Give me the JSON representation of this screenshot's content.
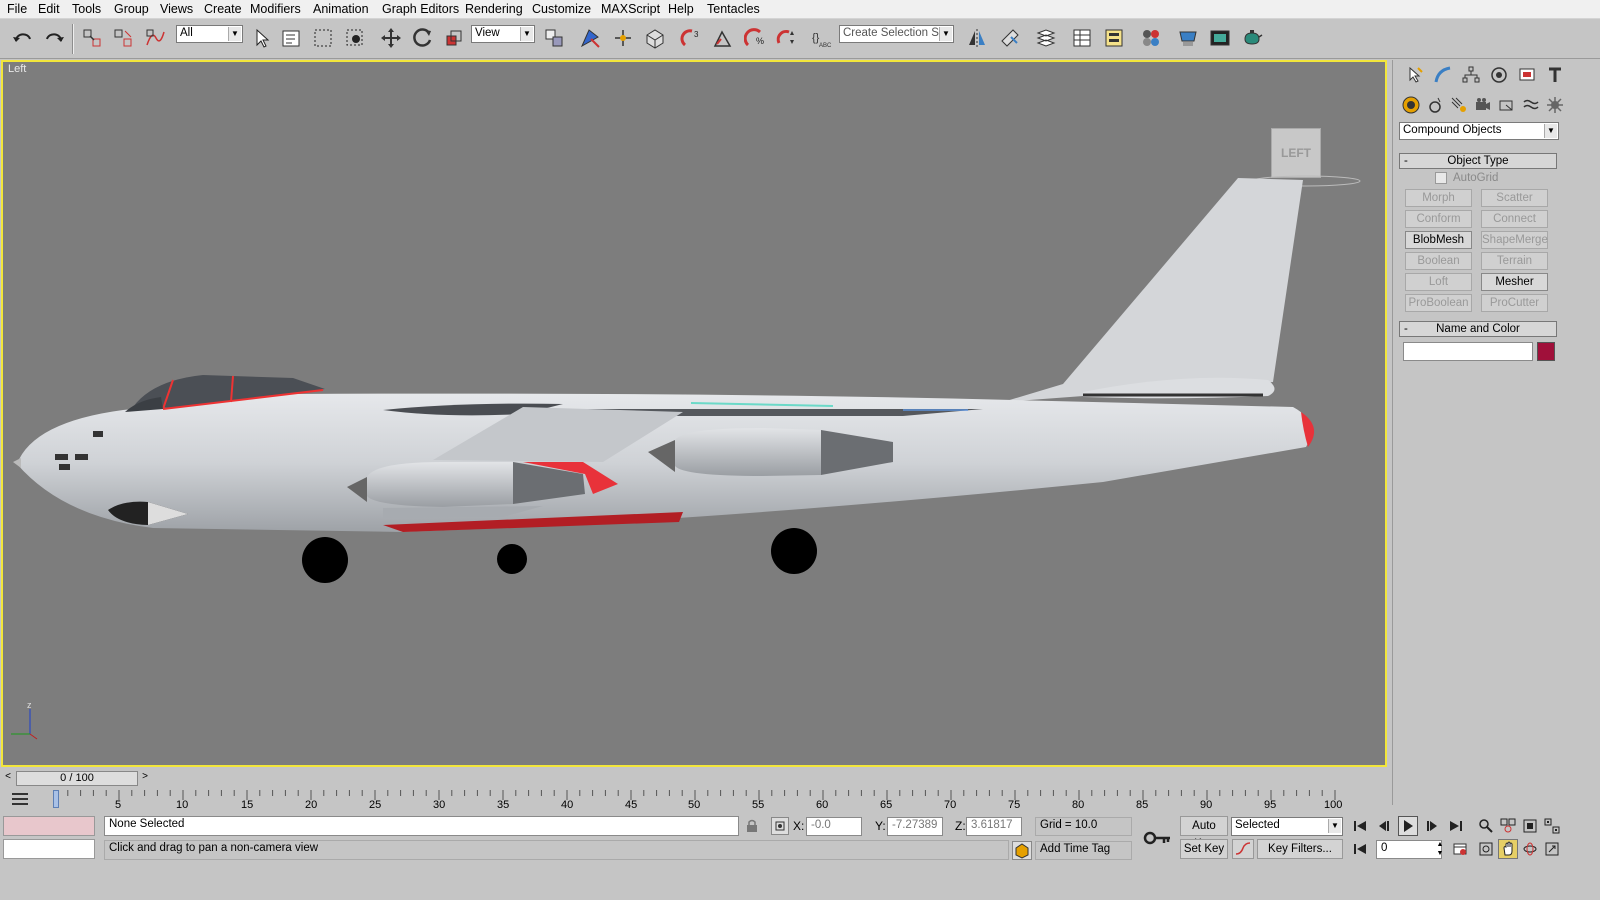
{
  "menu": [
    "File",
    "Edit",
    "Tools",
    "Group",
    "Views",
    "Create",
    "Modifiers",
    "Animation",
    "Graph Editors",
    "Rendering",
    "Customize",
    "MAXScript",
    "Help",
    "Tentacles"
  ],
  "toolbar": {
    "filter_value": "All",
    "refcoord_value": "View",
    "selection_set_placeholder": "Create Selection Set"
  },
  "viewport": {
    "label": "Left",
    "viewcube_label": "LEFT",
    "axis_z": "z"
  },
  "command_panel": {
    "category": "Compound Objects",
    "object_type_title": "Object Type",
    "autogrid_label": "AutoGrid",
    "autogrid_checked": false,
    "buttons": [
      {
        "label": "Morph",
        "enabled": false
      },
      {
        "label": "Scatter",
        "enabled": false
      },
      {
        "label": "Conform",
        "enabled": false
      },
      {
        "label": "Connect",
        "enabled": false
      },
      {
        "label": "BlobMesh",
        "enabled": true
      },
      {
        "label": "ShapeMerge",
        "enabled": false
      },
      {
        "label": "Boolean",
        "enabled": false
      },
      {
        "label": "Terrain",
        "enabled": false
      },
      {
        "label": "Loft",
        "enabled": false
      },
      {
        "label": "Mesher",
        "enabled": true
      },
      {
        "label": "ProBoolean",
        "enabled": false
      },
      {
        "label": "ProCutter",
        "enabled": false
      }
    ],
    "name_color_title": "Name and Color",
    "name_value": "",
    "object_color": "#a0103a"
  },
  "time_slider": {
    "frame_label": "0 / 100",
    "ticks": [
      "5",
      "10",
      "15",
      "20",
      "25",
      "30",
      "35",
      "40",
      "45",
      "50",
      "55",
      "60",
      "65",
      "70",
      "75",
      "80",
      "85",
      "90",
      "95",
      "100"
    ]
  },
  "status": {
    "selection": "None Selected",
    "prompt": "Click and drag to pan a non-camera view",
    "x_label": "X:",
    "x_value": "-0.0",
    "y_label": "Y:",
    "y_value": "-7.27389",
    "z_label": "Z:",
    "z_value": "3.61817",
    "grid": "Grid = 10.0",
    "add_time_tag": "Add Time Tag",
    "auto_key": "Auto Key",
    "set_key": "Set Key",
    "key_mode_value": "Selected",
    "key_filters": "Key Filters...",
    "current_frame": "0"
  }
}
